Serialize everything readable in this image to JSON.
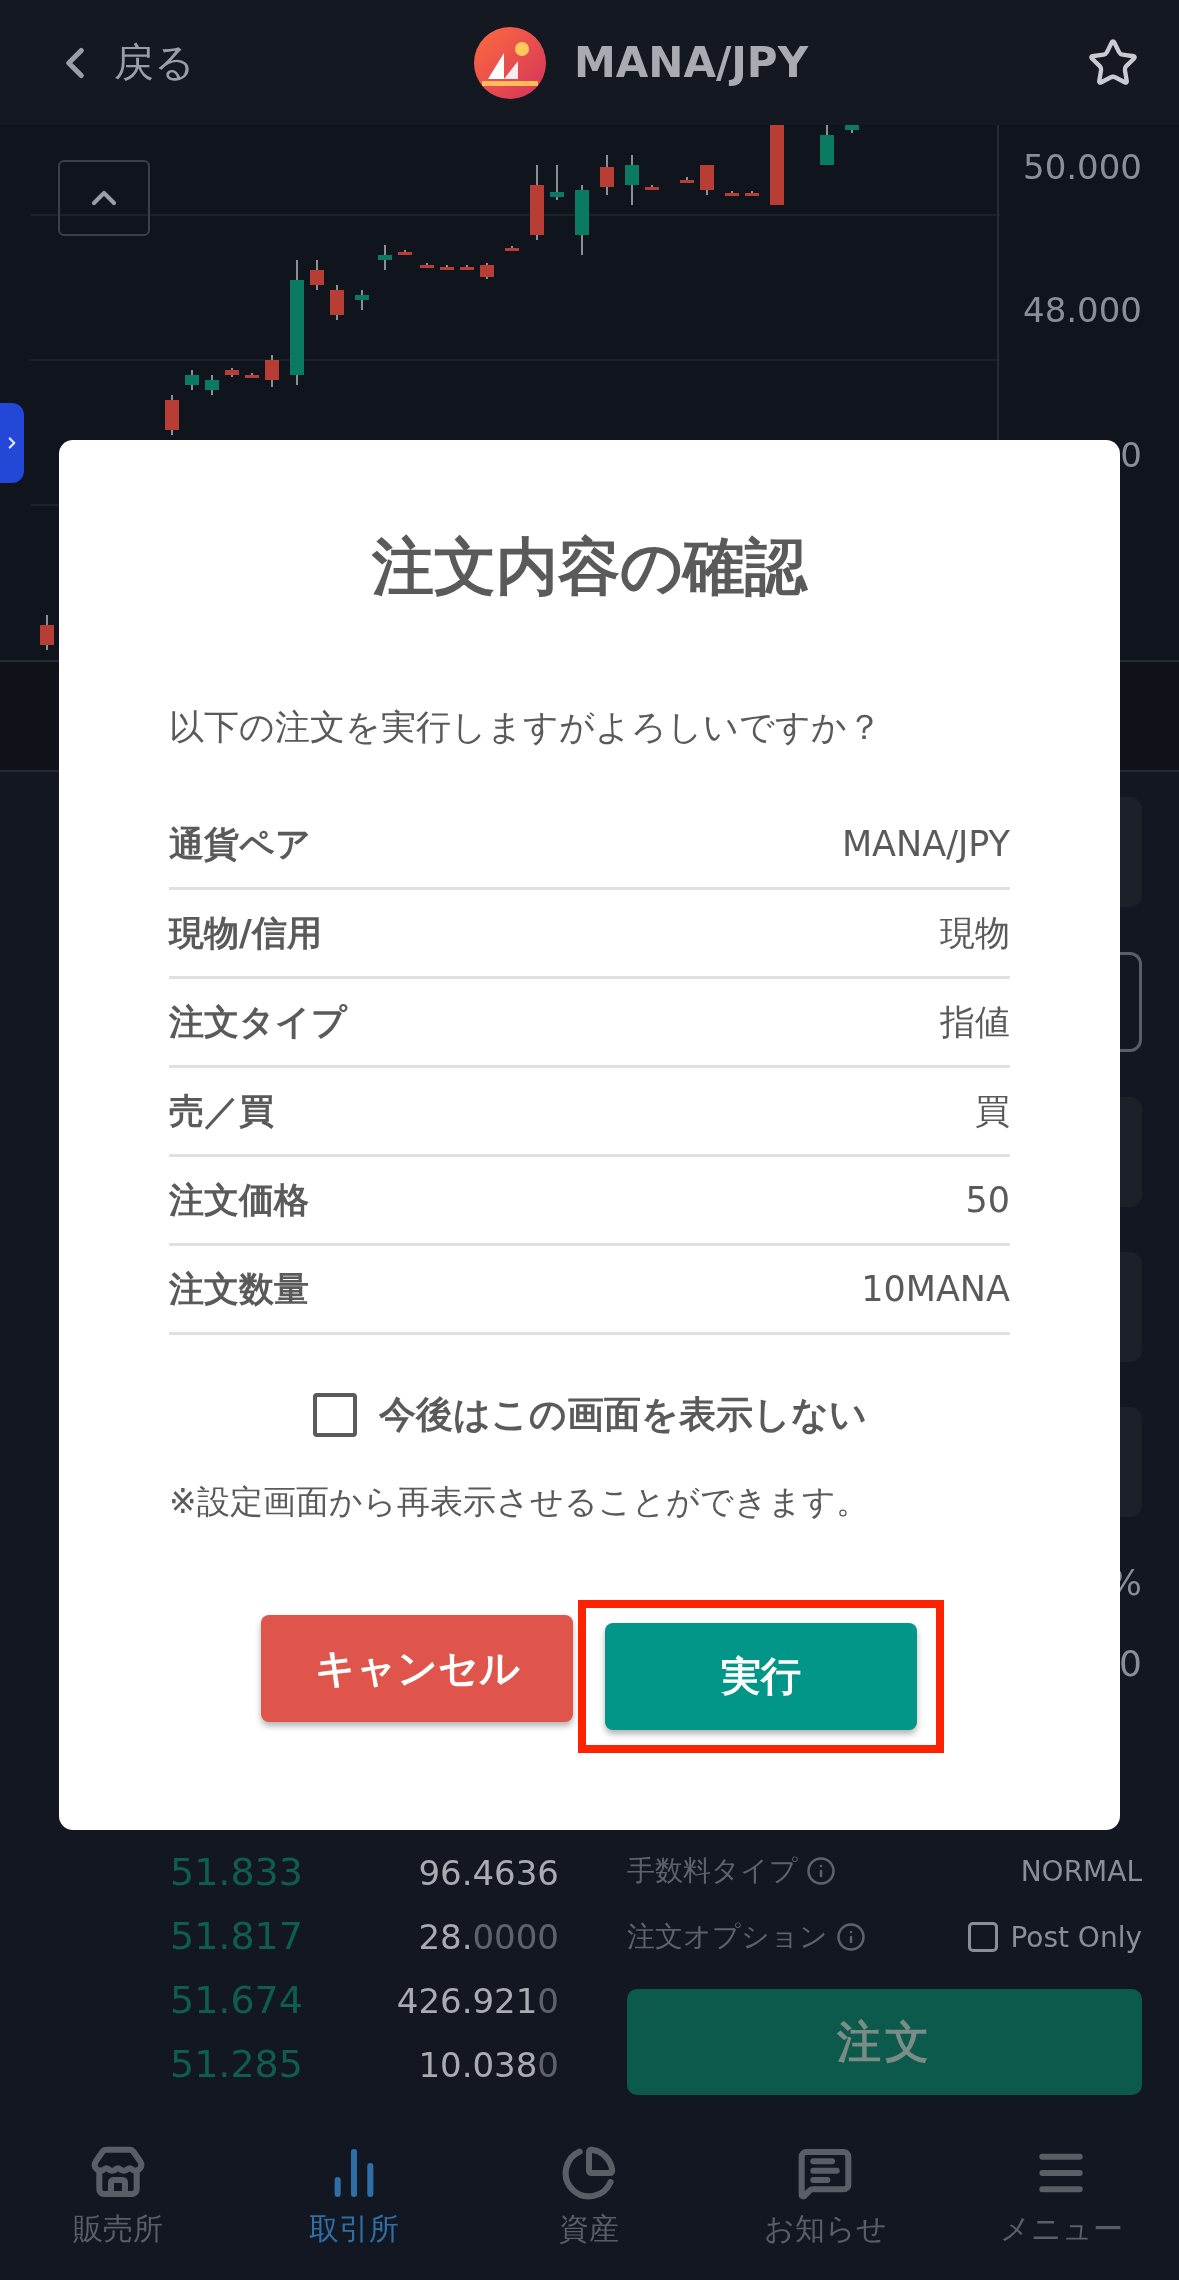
{
  "header": {
    "back_label": "戻る",
    "pair": "MANA/JPY",
    "favorite": false
  },
  "chart": {
    "axis_labels": [
      "50.000",
      "48.000",
      "0"
    ]
  },
  "form": {
    "right_edge_texts": [
      "%",
      "0"
    ]
  },
  "order_book": [
    {
      "price": "51.833",
      "amount_main": "96.4636"
    },
    {
      "price": "51.817",
      "amount_main": "28.",
      "amount_trailing": "0000"
    },
    {
      "price": "51.674",
      "amount_main": "426.921",
      "amount_trailing": "0"
    },
    {
      "price": "51.285",
      "amount_main": "10.038",
      "amount_trailing": "0"
    }
  ],
  "fee_type": {
    "label": "手数料タイプ",
    "value": "NORMAL"
  },
  "order_option": {
    "label": "注文オプション",
    "option_label": "Post Only",
    "checked": false
  },
  "order_button": "注文",
  "nav": [
    {
      "kind": "store",
      "label": "販売所",
      "selected": false
    },
    {
      "kind": "exchange",
      "label": "取引所",
      "selected": true
    },
    {
      "kind": "assets",
      "label": "資産",
      "selected": false
    },
    {
      "kind": "news",
      "label": "お知らせ",
      "selected": false
    },
    {
      "kind": "menu",
      "label": "メニュー",
      "selected": false
    }
  ],
  "dialog": {
    "title": "注文内容の確認",
    "message": "以下の注文を実行しますがよろしいですか？",
    "rows": [
      {
        "label": "通貨ペア",
        "value": "MANA/JPY"
      },
      {
        "label": "現物/信用",
        "value": "現物"
      },
      {
        "label": "注文タイプ",
        "value": "指値"
      },
      {
        "label": "売／買",
        "value": "買"
      },
      {
        "label": "注文価格",
        "value": "50"
      },
      {
        "label": "注文数量",
        "value": "10MANA"
      }
    ],
    "dont_show_again": {
      "label": "今後はこの画面を表示しない",
      "checked": false
    },
    "note": "※設定画面から再表示させることができます。",
    "cancel_button": "キャンセル",
    "execute_button": "実行",
    "execute_highlighted": true
  }
}
